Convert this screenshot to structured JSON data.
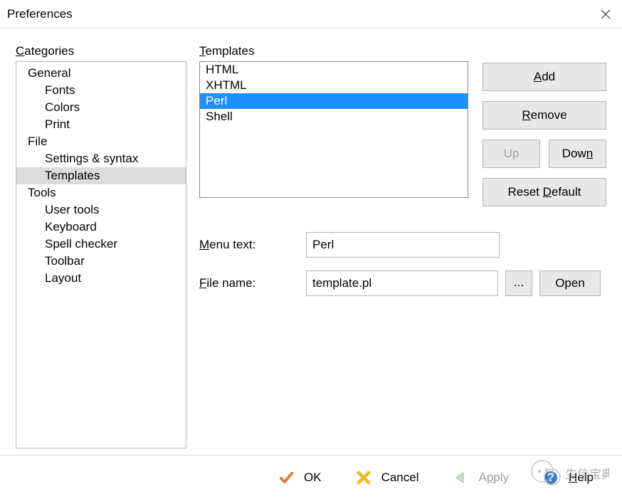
{
  "window": {
    "title": "Preferences"
  },
  "categories": {
    "label": "Categories",
    "items": [
      {
        "label": "General",
        "level": 1
      },
      {
        "label": "Fonts",
        "level": 2
      },
      {
        "label": "Colors",
        "level": 2
      },
      {
        "label": "Print",
        "level": 2
      },
      {
        "label": "File",
        "level": 1
      },
      {
        "label": "Settings & syntax",
        "level": 2
      },
      {
        "label": "Templates",
        "level": 2,
        "selected": true
      },
      {
        "label": "Tools",
        "level": 1
      },
      {
        "label": "User tools",
        "level": 2
      },
      {
        "label": "Keyboard",
        "level": 2
      },
      {
        "label": "Spell checker",
        "level": 2
      },
      {
        "label": "Toolbar",
        "level": 2
      },
      {
        "label": "Layout",
        "level": 2
      }
    ]
  },
  "templates": {
    "label": "Templates",
    "items": [
      {
        "label": "HTML"
      },
      {
        "label": "XHTML"
      },
      {
        "label": "Perl",
        "selected": true
      },
      {
        "label": "Shell"
      }
    ]
  },
  "buttons": {
    "add": "Add",
    "remove": "Remove",
    "up": "Up",
    "down": "Down",
    "reset": "Reset Default",
    "browse": "...",
    "open": "Open",
    "ok": "OK",
    "cancel": "Cancel",
    "apply": "Apply",
    "help": "Help"
  },
  "form": {
    "menu_text_label": "Menu text:",
    "file_name_label": "File name:",
    "menu_text_value": "Perl",
    "file_name_value": "template.pl"
  }
}
